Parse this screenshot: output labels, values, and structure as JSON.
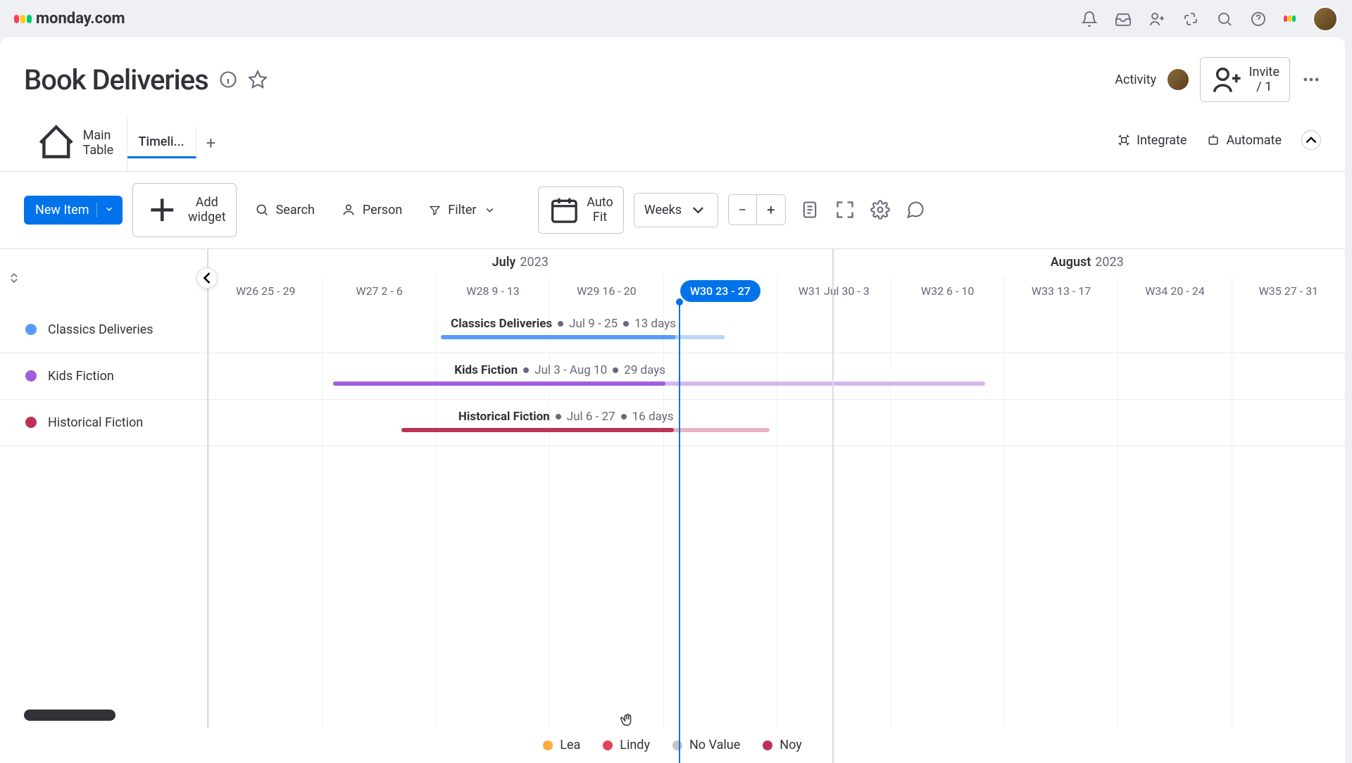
{
  "app": {
    "name": "monday.com"
  },
  "board": {
    "title": "Book Deliveries",
    "activity_label": "Activity",
    "invite_label": "Invite / 1"
  },
  "tabs": {
    "main": "Main Table",
    "timeline": "Timeli...",
    "integrate": "Integrate",
    "automate": "Automate"
  },
  "toolbar": {
    "new_item": "New Item",
    "add_widget": "Add widget",
    "search": "Search",
    "person": "Person",
    "filter": "Filter",
    "auto_fit": "Auto Fit",
    "period": "Weeks"
  },
  "timeline": {
    "months": [
      {
        "name": "July",
        "year": "2023"
      },
      {
        "name": "August",
        "year": "2023"
      }
    ],
    "month_boundary_col": 5.5,
    "weeks": [
      {
        "label": "W26 25 - 29",
        "active": false
      },
      {
        "label": "W27 2 - 6",
        "active": false
      },
      {
        "label": "W28 9 - 13",
        "active": false
      },
      {
        "label": "W29 16 - 20",
        "active": false
      },
      {
        "label": "W30 23 - 27",
        "active": true
      },
      {
        "label": "W31 Jul 30 - 3",
        "active": false
      },
      {
        "label": "W32 6 - 10",
        "active": false
      },
      {
        "label": "W33 13 - 17",
        "active": false
      },
      {
        "label": "W34 20 - 24",
        "active": false
      },
      {
        "label": "W35 27 - 31",
        "active": false
      }
    ],
    "today_col": 4.15,
    "groups": [
      {
        "name": "Classics Deliveries",
        "color": "#579bfc",
        "bar": {
          "name": "Classics Deliveries",
          "range": "Jul 9 - 25",
          "days": "13 days",
          "start_col": 2.05,
          "end_col": 4.55,
          "done_frac": 0.83,
          "track": "#bcd6f7",
          "fill": "#579bfc"
        }
      },
      {
        "name": "Kids Fiction",
        "color": "#a25ddc",
        "bar": {
          "name": "Kids Fiction",
          "range": "Jul 3 - Aug 10",
          "days": "29 days",
          "start_col": 1.1,
          "end_col": 6.85,
          "done_frac": 0.51,
          "track": "#d4b8ed",
          "fill": "#a25ddc"
        }
      },
      {
        "name": "Historical Fiction",
        "color": "#bb3354",
        "bar": {
          "name": "Historical Fiction",
          "range": "Jul 6 - 27",
          "days": "16 days",
          "start_col": 1.7,
          "end_col": 4.95,
          "done_frac": 0.74,
          "track": "#e6b6c2",
          "fill": "#bb3354"
        }
      }
    ]
  },
  "legend": [
    {
      "name": "Lea",
      "color": "#fdab3d"
    },
    {
      "name": "Lindy",
      "color": "#e2445c"
    },
    {
      "name": "No Value",
      "color": "#c4c4c4"
    },
    {
      "name": "Noy",
      "color": "#bb3354"
    }
  ],
  "chart_data": {
    "type": "gantt",
    "x_unit": "week",
    "x_categories": [
      "W26 25-29",
      "W27 2-6",
      "W28 9-13",
      "W29 16-20",
      "W30 23-27",
      "W31 Jul30-3",
      "W32 6-10",
      "W33 13-17",
      "W34 20-24",
      "W35 27-31"
    ],
    "today": "W30 (Jul 24 2023)",
    "series": [
      {
        "name": "Classics Deliveries",
        "start": "2023-07-09",
        "end": "2023-07-25",
        "days": 13,
        "color": "#579bfc"
      },
      {
        "name": "Kids Fiction",
        "start": "2023-07-03",
        "end": "2023-08-10",
        "days": 29,
        "color": "#a25ddc"
      },
      {
        "name": "Historical Fiction",
        "start": "2023-07-06",
        "end": "2023-07-27",
        "days": 16,
        "color": "#bb3354"
      }
    ]
  }
}
